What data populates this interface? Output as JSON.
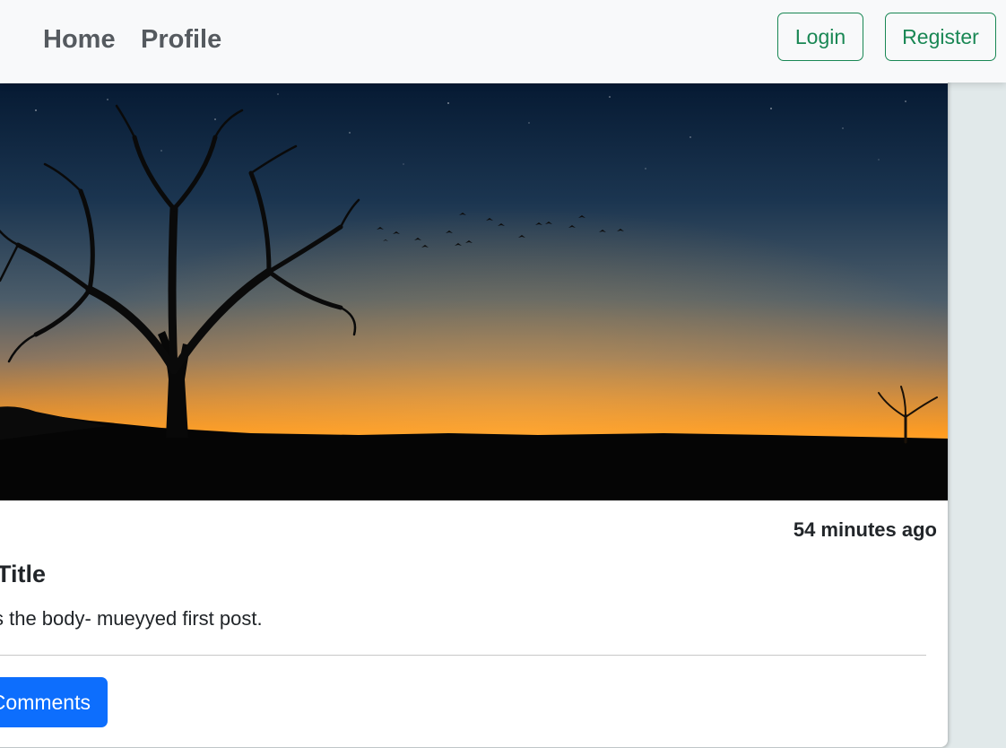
{
  "navbar": {
    "links": [
      {
        "label": "Home"
      },
      {
        "label": "Profile"
      }
    ],
    "login_label": "Login",
    "register_label": "Register",
    "accent_color": "#198754"
  },
  "post": {
    "image_subject": "sunset landscape with silhouetted tree and flock of birds",
    "timestamp": "54 minutes ago",
    "title": "o Title",
    "body": "s is the body- mueyyed first post.",
    "comments_button_label": "Comments",
    "comments_button_color": "#0d6efd"
  }
}
